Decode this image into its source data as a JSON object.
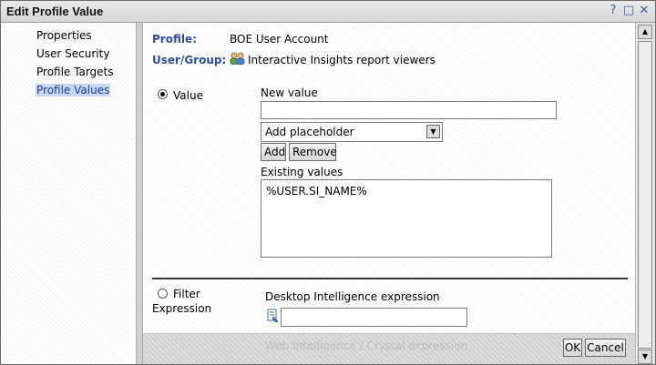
{
  "window": {
    "title": "Edit Profile Value",
    "controls": {
      "help": "?",
      "restore": "□",
      "close": "✕"
    }
  },
  "sidebar": {
    "items": [
      {
        "label": "Properties"
      },
      {
        "label": "User Security"
      },
      {
        "label": "Profile Targets"
      },
      {
        "label": "Profile Values",
        "selected": true
      }
    ]
  },
  "header": {
    "profile_label": "Profile:",
    "profile_value": "BOE User Account",
    "usergroup_label": "User/Group:",
    "usergroup_value": "Interactive Insights report viewers"
  },
  "value_section": {
    "radio_label": "Value",
    "new_value_label": "New value",
    "new_value": "",
    "placeholder_select": "Add placeholder",
    "add_button": "Add",
    "remove_button": "Remove",
    "existing_values_label": "Existing values",
    "existing_values": [
      "%USER.SI_NAME%"
    ]
  },
  "filter_section": {
    "radio_label_1": "Filter",
    "radio_label_2": "Expression",
    "desktop_label": "Desktop Intelligence expression",
    "desktop_value": "",
    "faded_label": "Web Intelligence / Crystal expression"
  },
  "footer": {
    "ok_button": "OK",
    "cancel_button": "Cancel"
  },
  "colors": {
    "accent_blue": "#2c4ea5",
    "selected_bg": "#c8d7f0"
  }
}
